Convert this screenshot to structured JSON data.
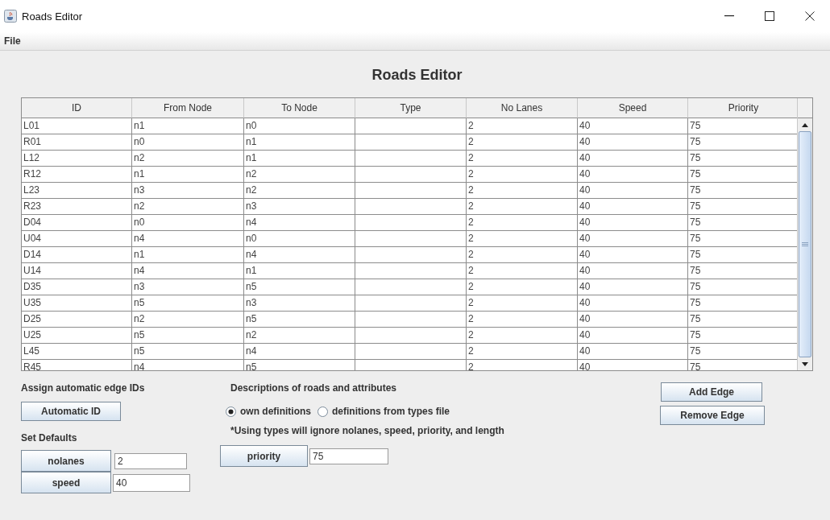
{
  "window": {
    "title": "Roads Editor"
  },
  "menu": [
    "File"
  ],
  "heading": "Roads Editor",
  "table": {
    "columns": [
      "ID",
      "From Node",
      "To Node",
      "Type",
      "No Lanes",
      "Speed",
      "Priority"
    ],
    "rows": [
      {
        "id": "L01",
        "from": "n1",
        "to": "n0",
        "lanes": "2",
        "speed": "40",
        "priority": "75"
      },
      {
        "id": "R01",
        "from": "n0",
        "to": "n1",
        "lanes": "2",
        "speed": "40",
        "priority": "75"
      },
      {
        "id": "L12",
        "from": "n2",
        "to": "n1",
        "lanes": "2",
        "speed": "40",
        "priority": "75"
      },
      {
        "id": "R12",
        "from": "n1",
        "to": "n2",
        "lanes": "2",
        "speed": "40",
        "priority": "75"
      },
      {
        "id": "L23",
        "from": "n3",
        "to": "n2",
        "lanes": "2",
        "speed": "40",
        "priority": "75"
      },
      {
        "id": "R23",
        "from": "n2",
        "to": "n3",
        "lanes": "2",
        "speed": "40",
        "priority": "75"
      },
      {
        "id": "D04",
        "from": "n0",
        "to": "n4",
        "lanes": "2",
        "speed": "40",
        "priority": "75"
      },
      {
        "id": "U04",
        "from": "n4",
        "to": "n0",
        "lanes": "2",
        "speed": "40",
        "priority": "75"
      },
      {
        "id": "D14",
        "from": "n1",
        "to": "n4",
        "lanes": "2",
        "speed": "40",
        "priority": "75"
      },
      {
        "id": "U14",
        "from": "n4",
        "to": "n1",
        "lanes": "2",
        "speed": "40",
        "priority": "75"
      },
      {
        "id": "D35",
        "from": "n3",
        "to": "n5",
        "lanes": "2",
        "speed": "40",
        "priority": "75"
      },
      {
        "id": "U35",
        "from": "n5",
        "to": "n3",
        "lanes": "2",
        "speed": "40",
        "priority": "75"
      },
      {
        "id": "D25",
        "from": "n2",
        "to": "n5",
        "lanes": "2",
        "speed": "40",
        "priority": "75"
      },
      {
        "id": "U25",
        "from": "n5",
        "to": "n2",
        "lanes": "2",
        "speed": "40",
        "priority": "75"
      },
      {
        "id": "L45",
        "from": "n5",
        "to": "n4",
        "lanes": "2",
        "speed": "40",
        "priority": "75"
      },
      {
        "id": "R45",
        "from": "n4",
        "to": "n5",
        "lanes": "2",
        "speed": "40",
        "priority": "75"
      }
    ]
  },
  "auto_ids": {
    "label": "Assign automatic edge IDs",
    "button": "Automatic ID"
  },
  "defaults": {
    "label": "Set Defaults",
    "nolanes": {
      "button": "nolanes",
      "value": "2"
    },
    "speed": {
      "button": "speed",
      "value": "40"
    },
    "priority": {
      "button": "priority",
      "value": "75"
    }
  },
  "descriptions": {
    "label": "Descriptions of roads and attributes",
    "options": [
      {
        "label": "own definitions",
        "selected": true
      },
      {
        "label": "definitions from types file",
        "selected": false
      }
    ],
    "note": "*Using types will ignore nolanes, speed, priority, and length"
  },
  "edge_buttons": [
    "Add Edge",
    "Remove Edge"
  ]
}
